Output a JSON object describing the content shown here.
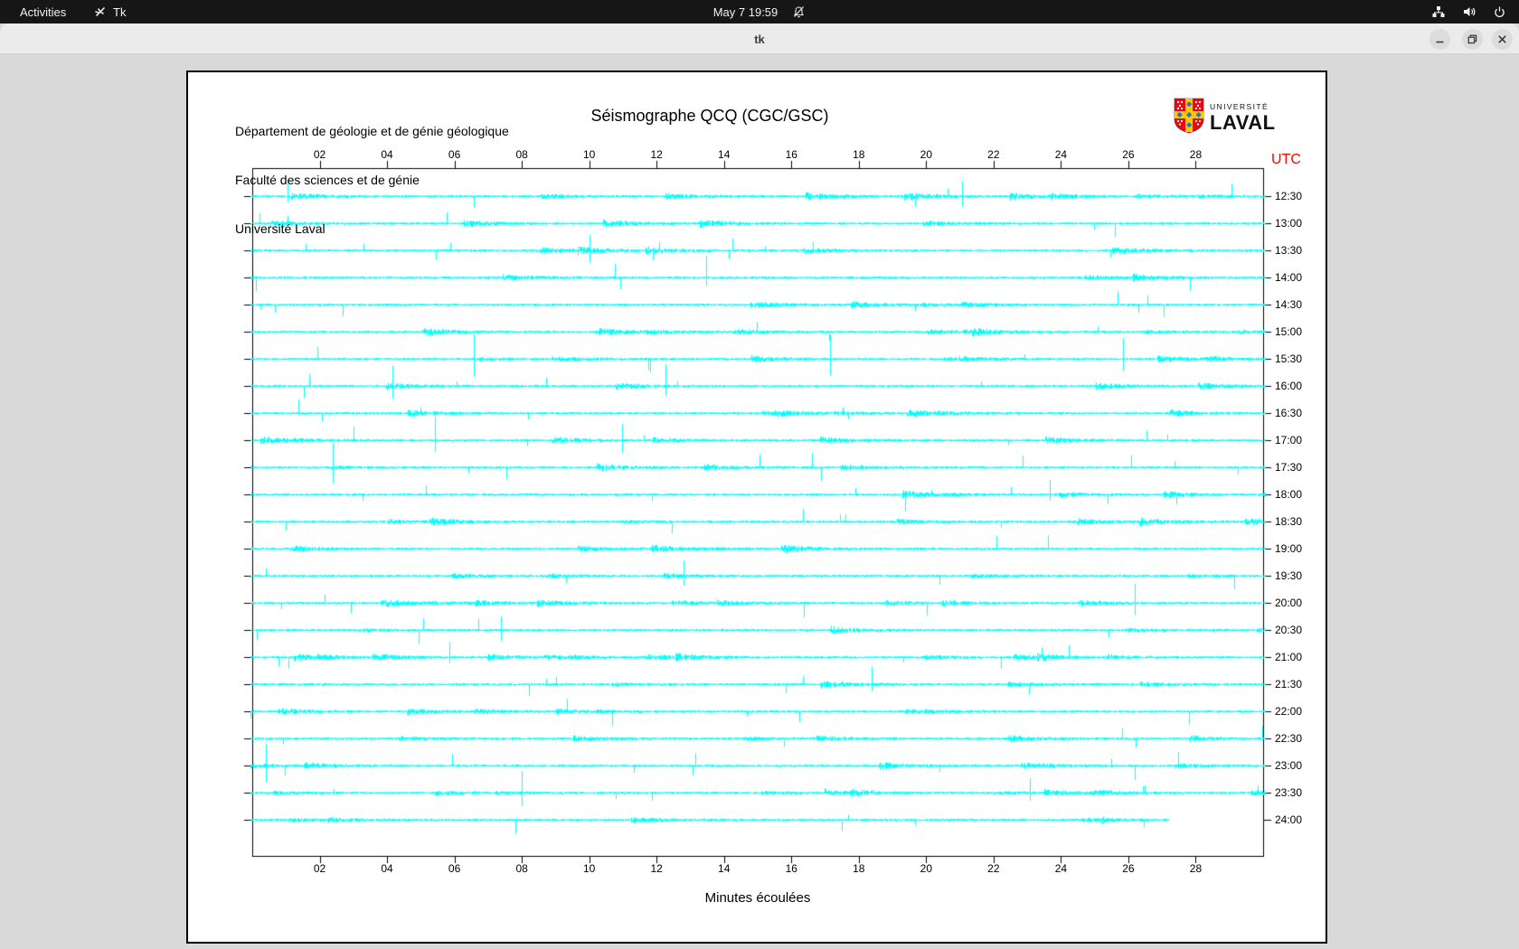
{
  "top_bar": {
    "activities_label": "Activities",
    "app_name": "Tk",
    "clock": "May 7  19:59",
    "icons": [
      "tk-app-icon",
      "notifications-muted-bell-icon",
      "network-wired-icon",
      "volume-icon",
      "power-icon"
    ]
  },
  "window": {
    "title": "tk",
    "buttons": [
      "minimize",
      "maximize",
      "close"
    ]
  },
  "plot": {
    "header_lines": [
      "Département de géologie et de génie géologique",
      "Faculté des sciences et de génie",
      "Université Laval"
    ],
    "title": "Séismographe QCQ (CGC/GSC)",
    "utc_label": "UTC",
    "xlabel": "Minutes écoulées",
    "x_ticks": [
      "02",
      "04",
      "06",
      "08",
      "10",
      "12",
      "14",
      "16",
      "18",
      "20",
      "22",
      "24",
      "26",
      "28"
    ],
    "y_labels": [
      "12:30",
      "13:00",
      "13:30",
      "14:00",
      "14:30",
      "15:00",
      "15:30",
      "16:00",
      "16:30",
      "17:00",
      "17:30",
      "18:00",
      "18:30",
      "19:00",
      "19:30",
      "20:00",
      "20:30",
      "21:00",
      "21:30",
      "22:00",
      "22:30",
      "23:00",
      "23:30",
      "24:00"
    ],
    "trace_color": "#00FFFF",
    "frame_color": "#000000",
    "utc_color": "#FF0000"
  },
  "logo": {
    "line1": "UNIVERSITÉ",
    "line2": "LAVAL",
    "shield_red": "#E30B17",
    "shield_gold": "#FFC60B",
    "shield_blue": "#1A7AC4"
  },
  "chart_data": {
    "type": "line",
    "subtype": "helicorder-seismogram",
    "title": "Séismographe QCQ (CGC/GSC)",
    "xlabel": "Minutes écoulées",
    "x_range_minutes": [
      0,
      30
    ],
    "x_tick_labels": [
      "02",
      "04",
      "06",
      "08",
      "10",
      "12",
      "14",
      "16",
      "18",
      "20",
      "22",
      "24",
      "26",
      "28"
    ],
    "y_axis_label": "UTC",
    "rows": [
      "12:30",
      "13:00",
      "13:30",
      "14:00",
      "14:30",
      "15:00",
      "15:30",
      "16:00",
      "16:30",
      "17:00",
      "17:30",
      "18:00",
      "18:30",
      "19:00",
      "19:30",
      "20:00",
      "20:30",
      "21:00",
      "21:30",
      "22:00",
      "22:30",
      "23:00",
      "23:30",
      "24:00"
    ],
    "row_duration_minutes": 30,
    "last_row_end_minute": 27.2,
    "description": "24 consecutive half-hour seismic traces (ambient noise with intermittent transient spikes), drawn in cyan; the final 24:00 trace is incomplete.",
    "trace_color": "#00FFFF"
  }
}
